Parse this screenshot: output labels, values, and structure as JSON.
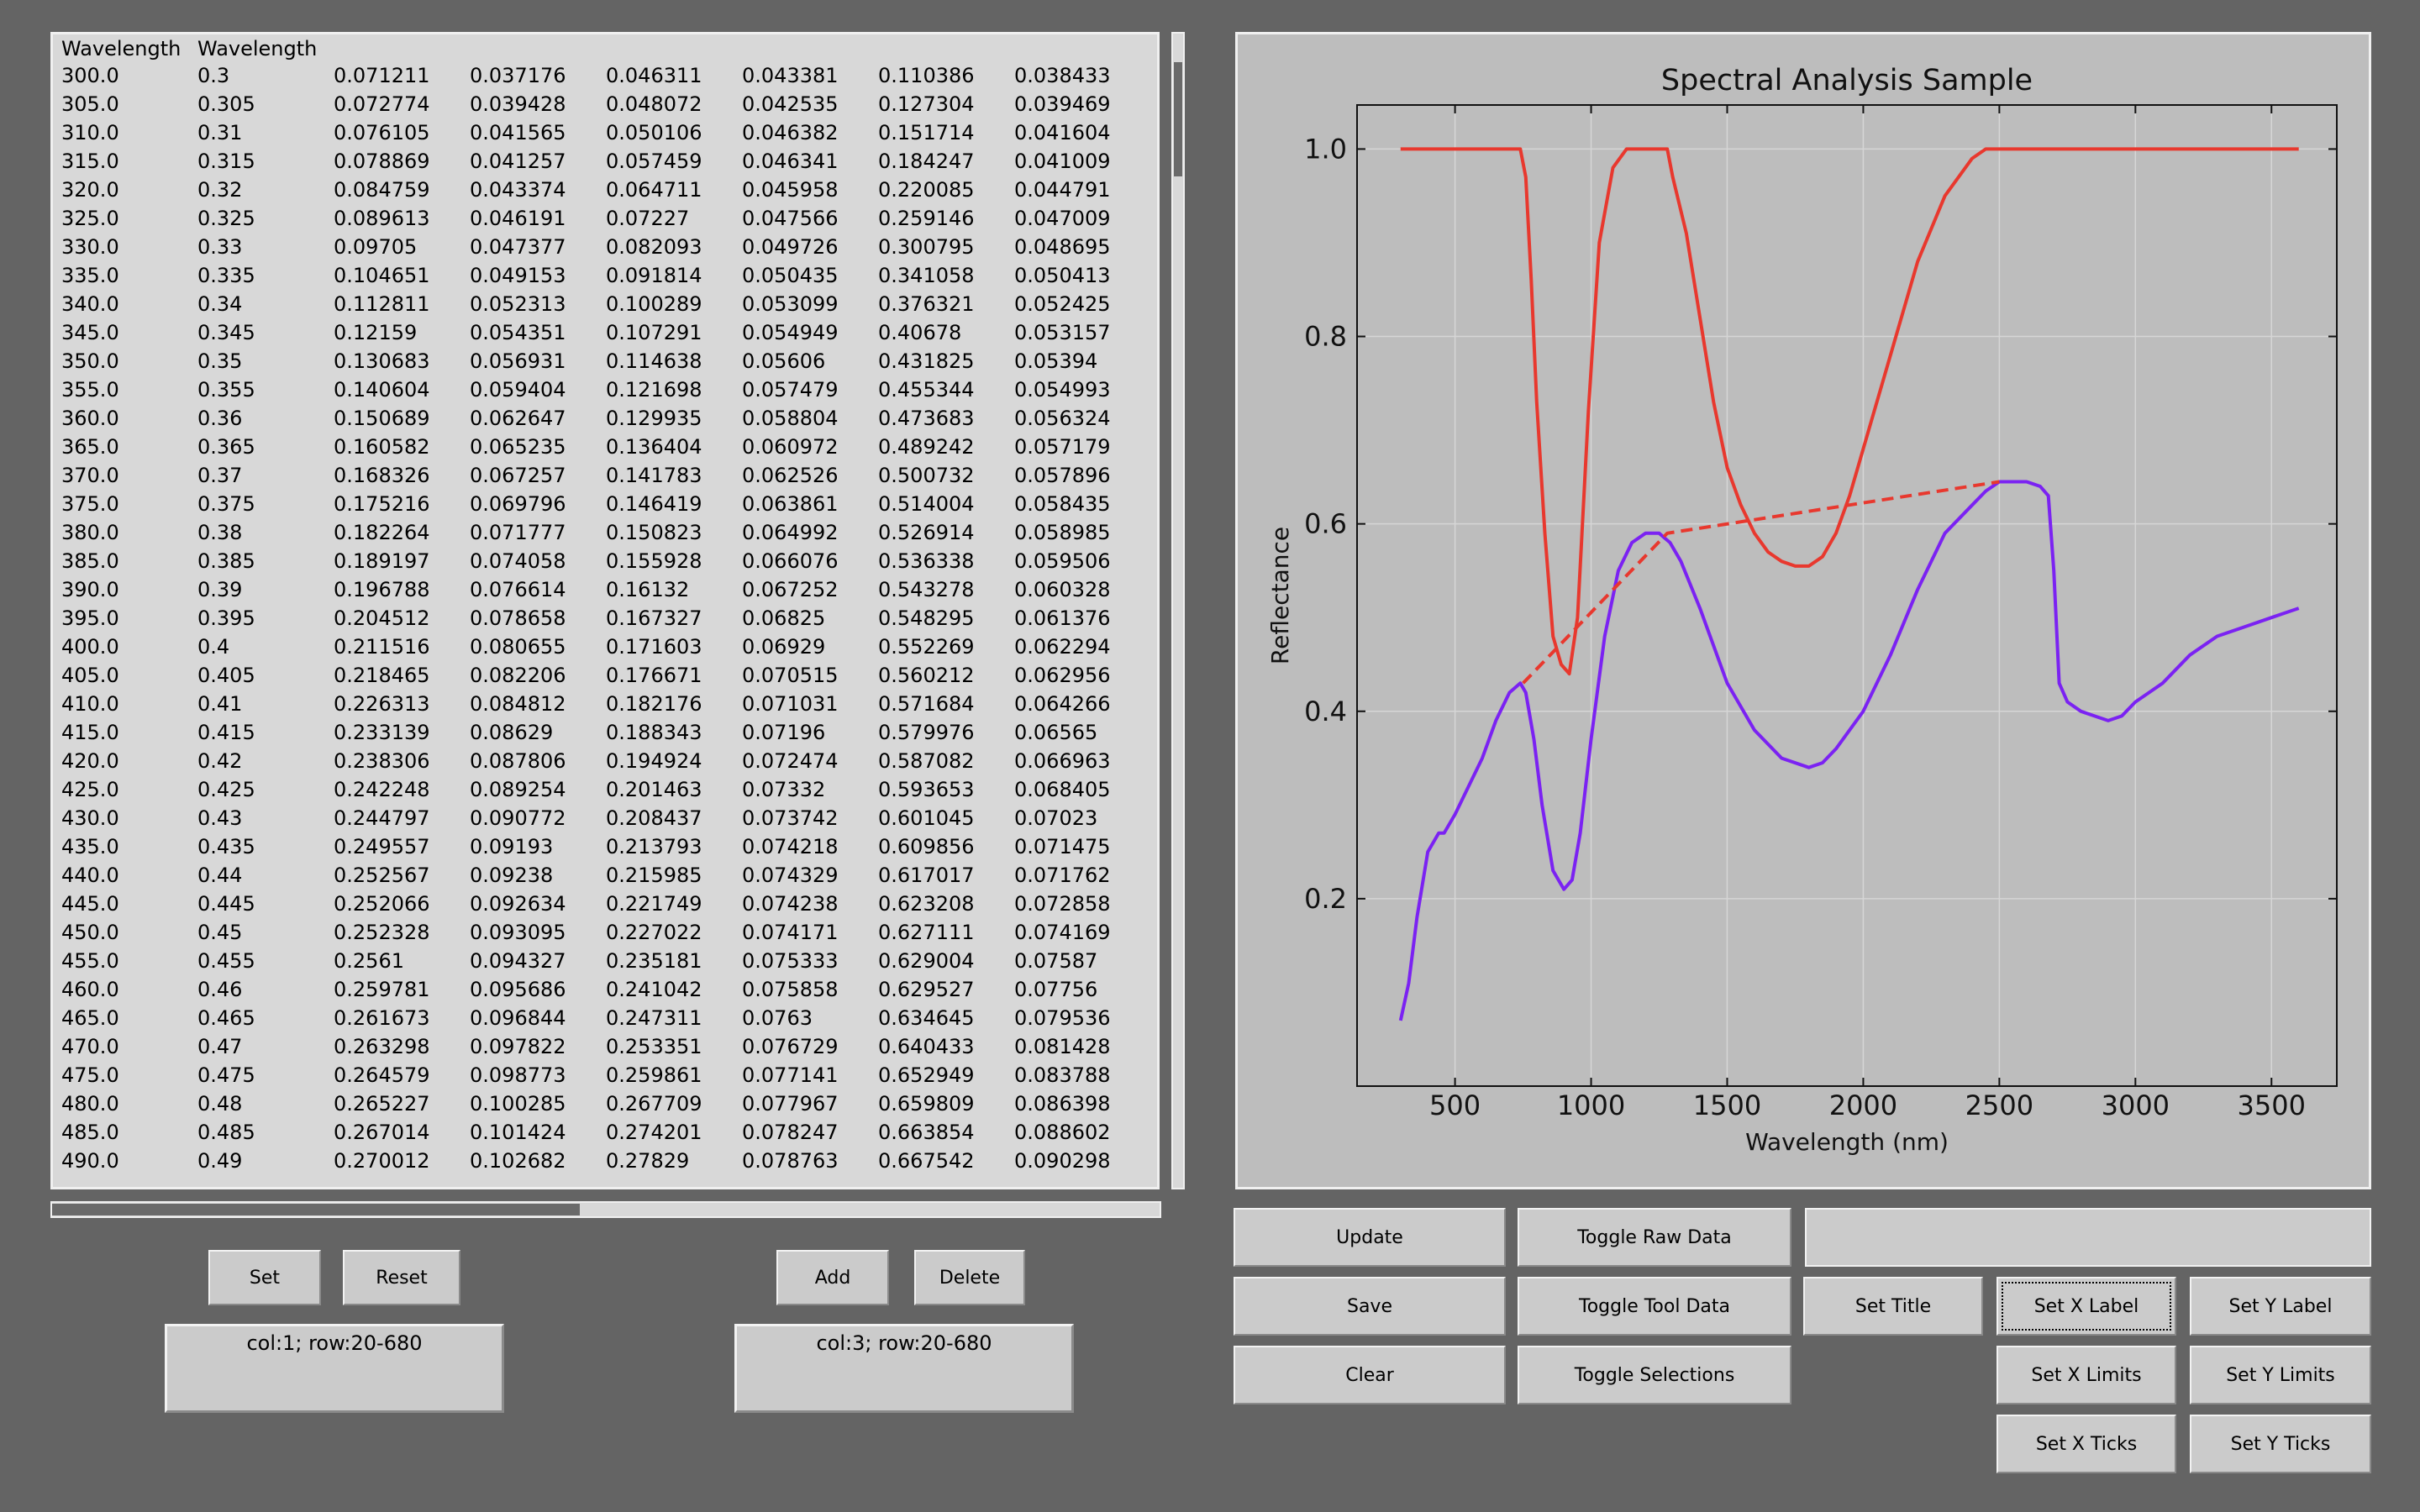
{
  "table": {
    "headers": [
      "Wavelength",
      "Wavelength",
      "",
      "",
      "",
      "",
      "",
      ""
    ],
    "rows": [
      [
        "300.0",
        "0.3",
        "0.071211",
        "0.037176",
        "0.046311",
        "0.043381",
        "0.110386",
        "0.038433"
      ],
      [
        "305.0",
        "0.305",
        "0.072774",
        "0.039428",
        "0.048072",
        "0.042535",
        "0.127304",
        "0.039469"
      ],
      [
        "310.0",
        "0.31",
        "0.076105",
        "0.041565",
        "0.050106",
        "0.046382",
        "0.151714",
        "0.041604"
      ],
      [
        "315.0",
        "0.315",
        "0.078869",
        "0.041257",
        "0.057459",
        "0.046341",
        "0.184247",
        "0.041009"
      ],
      [
        "320.0",
        "0.32",
        "0.084759",
        "0.043374",
        "0.064711",
        "0.045958",
        "0.220085",
        "0.044791"
      ],
      [
        "325.0",
        "0.325",
        "0.089613",
        "0.046191",
        "0.07227",
        "0.047566",
        "0.259146",
        "0.047009"
      ],
      [
        "330.0",
        "0.33",
        "0.09705",
        "0.047377",
        "0.082093",
        "0.049726",
        "0.300795",
        "0.048695"
      ],
      [
        "335.0",
        "0.335",
        "0.104651",
        "0.049153",
        "0.091814",
        "0.050435",
        "0.341058",
        "0.050413"
      ],
      [
        "340.0",
        "0.34",
        "0.112811",
        "0.052313",
        "0.100289",
        "0.053099",
        "0.376321",
        "0.052425"
      ],
      [
        "345.0",
        "0.345",
        "0.12159",
        "0.054351",
        "0.107291",
        "0.054949",
        "0.40678",
        "0.053157"
      ],
      [
        "350.0",
        "0.35",
        "0.130683",
        "0.056931",
        "0.114638",
        "0.05606",
        "0.431825",
        "0.05394"
      ],
      [
        "355.0",
        "0.355",
        "0.140604",
        "0.059404",
        "0.121698",
        "0.057479",
        "0.455344",
        "0.054993"
      ],
      [
        "360.0",
        "0.36",
        "0.150689",
        "0.062647",
        "0.129935",
        "0.058804",
        "0.473683",
        "0.056324"
      ],
      [
        "365.0",
        "0.365",
        "0.160582",
        "0.065235",
        "0.136404",
        "0.060972",
        "0.489242",
        "0.057179"
      ],
      [
        "370.0",
        "0.37",
        "0.168326",
        "0.067257",
        "0.141783",
        "0.062526",
        "0.500732",
        "0.057896"
      ],
      [
        "375.0",
        "0.375",
        "0.175216",
        "0.069796",
        "0.146419",
        "0.063861",
        "0.514004",
        "0.058435"
      ],
      [
        "380.0",
        "0.38",
        "0.182264",
        "0.071777",
        "0.150823",
        "0.064992",
        "0.526914",
        "0.058985"
      ],
      [
        "385.0",
        "0.385",
        "0.189197",
        "0.074058",
        "0.155928",
        "0.066076",
        "0.536338",
        "0.059506"
      ],
      [
        "390.0",
        "0.39",
        "0.196788",
        "0.076614",
        "0.16132",
        "0.067252",
        "0.543278",
        "0.060328"
      ],
      [
        "395.0",
        "0.395",
        "0.204512",
        "0.078658",
        "0.167327",
        "0.06825",
        "0.548295",
        "0.061376"
      ],
      [
        "400.0",
        "0.4",
        "0.211516",
        "0.080655",
        "0.171603",
        "0.06929",
        "0.552269",
        "0.062294"
      ],
      [
        "405.0",
        "0.405",
        "0.218465",
        "0.082206",
        "0.176671",
        "0.070515",
        "0.560212",
        "0.062956"
      ],
      [
        "410.0",
        "0.41",
        "0.226313",
        "0.084812",
        "0.182176",
        "0.071031",
        "0.571684",
        "0.064266"
      ],
      [
        "415.0",
        "0.415",
        "0.233139",
        "0.08629",
        "0.188343",
        "0.07196",
        "0.579976",
        "0.06565"
      ],
      [
        "420.0",
        "0.42",
        "0.238306",
        "0.087806",
        "0.194924",
        "0.072474",
        "0.587082",
        "0.066963"
      ],
      [
        "425.0",
        "0.425",
        "0.242248",
        "0.089254",
        "0.201463",
        "0.07332",
        "0.593653",
        "0.068405"
      ],
      [
        "430.0",
        "0.43",
        "0.244797",
        "0.090772",
        "0.208437",
        "0.073742",
        "0.601045",
        "0.07023"
      ],
      [
        "435.0",
        "0.435",
        "0.249557",
        "0.09193",
        "0.213793",
        "0.074218",
        "0.609856",
        "0.071475"
      ],
      [
        "440.0",
        "0.44",
        "0.252567",
        "0.09238",
        "0.215985",
        "0.074329",
        "0.617017",
        "0.071762"
      ],
      [
        "445.0",
        "0.445",
        "0.252066",
        "0.092634",
        "0.221749",
        "0.074238",
        "0.623208",
        "0.072858"
      ],
      [
        "450.0",
        "0.45",
        "0.252328",
        "0.093095",
        "0.227022",
        "0.074171",
        "0.627111",
        "0.074169"
      ],
      [
        "455.0",
        "0.455",
        "0.2561",
        "0.094327",
        "0.235181",
        "0.075333",
        "0.629004",
        "0.07587"
      ],
      [
        "460.0",
        "0.46",
        "0.259781",
        "0.095686",
        "0.241042",
        "0.075858",
        "0.629527",
        "0.07756"
      ],
      [
        "465.0",
        "0.465",
        "0.261673",
        "0.096844",
        "0.247311",
        "0.0763",
        "0.634645",
        "0.079536"
      ],
      [
        "470.0",
        "0.47",
        "0.263298",
        "0.097822",
        "0.253351",
        "0.076729",
        "0.640433",
        "0.081428"
      ],
      [
        "475.0",
        "0.475",
        "0.264579",
        "0.098773",
        "0.259861",
        "0.077141",
        "0.652949",
        "0.083788"
      ],
      [
        "480.0",
        "0.48",
        "0.265227",
        "0.100285",
        "0.267709",
        "0.077967",
        "0.659809",
        "0.086398"
      ],
      [
        "485.0",
        "0.485",
        "0.267014",
        "0.101424",
        "0.274201",
        "0.078247",
        "0.663854",
        "0.088602"
      ],
      [
        "490.0",
        "0.49",
        "0.270012",
        "0.102682",
        "0.27829",
        "0.078763",
        "0.667542",
        "0.090298"
      ]
    ]
  },
  "left_controls": {
    "set_label": "Set",
    "reset_label": "Reset",
    "add_label": "Add",
    "delete_label": "Delete",
    "selection_a": "col:1; row:20-680",
    "selection_b": "col:3; row:20-680"
  },
  "plot_controls": {
    "update": "Update",
    "toggle_raw": "Toggle Raw Data",
    "text_value": "",
    "save": "Save",
    "toggle_tool": "Toggle Tool Data",
    "set_title": "Set Title",
    "set_xlabel": "Set X Label",
    "set_ylabel": "Set Y Label",
    "clear": "Clear",
    "toggle_sel": "Toggle Selections",
    "set_xlimits": "Set X Limits",
    "set_ylimits": "Set Y Limits",
    "set_xticks": "Set X Ticks",
    "set_yticks": "Set Y Ticks"
  },
  "chart_data": {
    "type": "line",
    "title": "Spectral Analysis Sample",
    "xlabel": "Wavelength (nm)",
    "ylabel": "Reflectance",
    "xlim": [
      140,
      3740
    ],
    "ylim": [
      0.0,
      1.047
    ],
    "xticks": [
      500,
      1000,
      1500,
      2000,
      2500,
      3000,
      3500
    ],
    "xtick_labels": [
      "500",
      "1000",
      "1500",
      "2000",
      "2500",
      "3000",
      "3500"
    ],
    "yticks": [
      0.2,
      0.4,
      0.6,
      0.8,
      1.0
    ],
    "ytick_labels": [
      "0.2",
      "0.4",
      "0.6",
      "0.8",
      "1.0"
    ],
    "grid": true,
    "series": [
      {
        "color": "#7b22f2",
        "style": "solid",
        "x": [
          300,
          330,
          360,
          400,
          440,
          460,
          500,
          550,
          600,
          650,
          700,
          740,
          760,
          790,
          820,
          860,
          900,
          930,
          960,
          1000,
          1050,
          1100,
          1150,
          1200,
          1250,
          1290,
          1330,
          1400,
          1500,
          1600,
          1700,
          1800,
          1850,
          1900,
          2000,
          2100,
          2200,
          2300,
          2400,
          2450,
          2500,
          2550,
          2600,
          2650,
          2680,
          2700,
          2720,
          2750,
          2800,
          2850,
          2900,
          2950,
          3000,
          3050,
          3100,
          3200,
          3300,
          3400,
          3500,
          3550,
          3600
        ],
        "y": [
          0.07,
          0.11,
          0.18,
          0.25,
          0.27,
          0.27,
          0.29,
          0.32,
          0.35,
          0.39,
          0.42,
          0.43,
          0.42,
          0.37,
          0.3,
          0.23,
          0.21,
          0.22,
          0.27,
          0.37,
          0.48,
          0.55,
          0.58,
          0.59,
          0.59,
          0.58,
          0.56,
          0.51,
          0.43,
          0.38,
          0.35,
          0.34,
          0.345,
          0.36,
          0.4,
          0.46,
          0.53,
          0.59,
          0.62,
          0.635,
          0.645,
          0.645,
          0.645,
          0.64,
          0.63,
          0.55,
          0.43,
          0.41,
          0.4,
          0.395,
          0.39,
          0.395,
          0.41,
          0.42,
          0.43,
          0.46,
          0.48,
          0.49,
          0.5,
          0.505,
          0.51
        ]
      },
      {
        "color": "#e8382e",
        "style": "solid",
        "x": [
          300,
          400,
          500,
          600,
          700,
          740,
          760,
          780,
          800,
          830,
          860,
          890,
          920,
          950,
          990,
          1030,
          1080,
          1130,
          1160,
          1200,
          1250,
          1280,
          1300,
          1350,
          1400,
          1450,
          1500,
          1550,
          1600,
          1650,
          1700,
          1750,
          1800,
          1850,
          1900,
          1950,
          2000,
          2100,
          2200,
          2300,
          2400,
          2450,
          2500,
          2600,
          2800,
          3000,
          3200,
          3400,
          3600
        ],
        "y": [
          1.0,
          1.0,
          1.0,
          1.0,
          1.0,
          1.0,
          0.97,
          0.86,
          0.73,
          0.59,
          0.48,
          0.45,
          0.44,
          0.5,
          0.72,
          0.9,
          0.98,
          1.0,
          1.0,
          1.0,
          1.0,
          1.0,
          0.97,
          0.91,
          0.82,
          0.73,
          0.66,
          0.62,
          0.59,
          0.57,
          0.56,
          0.555,
          0.555,
          0.565,
          0.59,
          0.63,
          0.68,
          0.78,
          0.88,
          0.95,
          0.99,
          1.0,
          1.0,
          1.0,
          1.0,
          1.0,
          1.0,
          1.0,
          1.0
        ]
      },
      {
        "color": "#e8382e",
        "style": "dashed",
        "x": [
          750,
          1280,
          2500
        ],
        "y": [
          0.43,
          0.59,
          0.645
        ]
      }
    ]
  }
}
